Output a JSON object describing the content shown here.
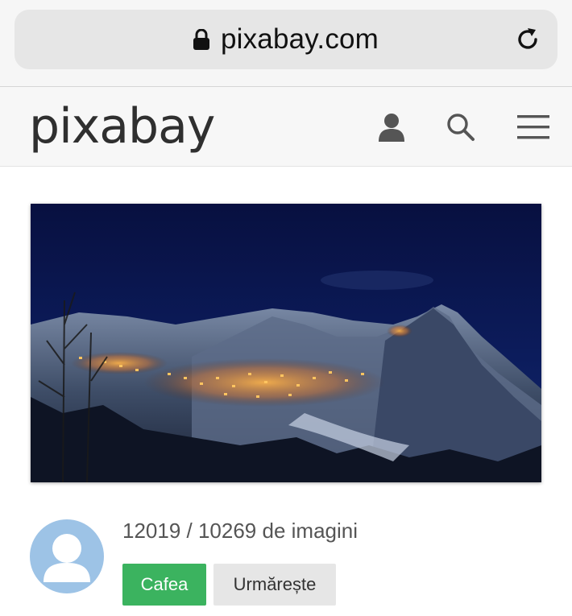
{
  "browser": {
    "url": "pixabay.com"
  },
  "header": {
    "logo": "pixabay"
  },
  "hero": {
    "alt": "Snowy mountain village at night"
  },
  "profile": {
    "image_count": "12019 / 10269 de imagini",
    "coffee_label": "Cafea",
    "follow_label": "Urmărește"
  },
  "colors": {
    "accent_green": "#3bb35f",
    "avatar_blue": "#9dc3e6",
    "logo_gray": "#2f2f2f"
  },
  "icons": [
    "lock-icon",
    "reload-icon",
    "user-icon",
    "search-icon",
    "menu-icon",
    "avatar"
  ]
}
